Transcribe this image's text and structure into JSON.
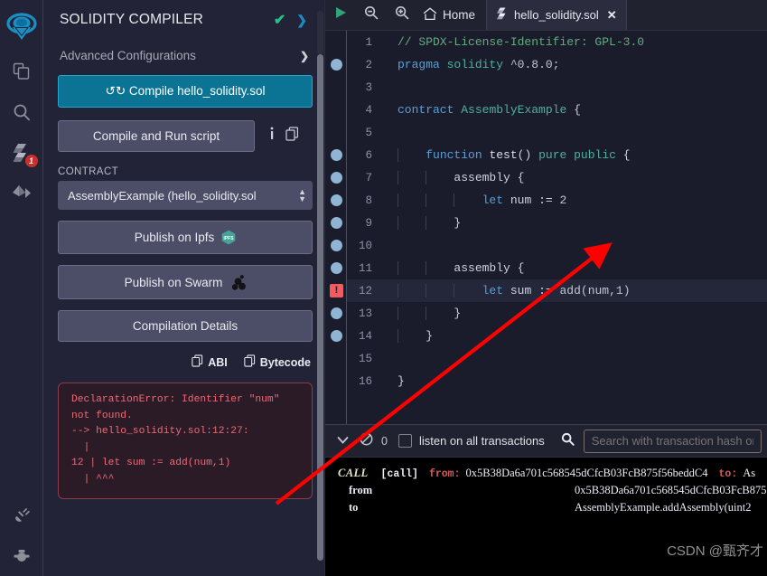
{
  "colors": {
    "accent_blue": "#0b7495",
    "panel_bg": "#222336",
    "editor_bg": "#1b1c2b",
    "error_red": "#ef6a78",
    "success_green": "#28c08a",
    "badge_red": "#c9302c",
    "arrow_red": "#ff0000"
  },
  "icon_rail": {
    "items": [
      {
        "name": "remix-logo",
        "label": "Remix"
      },
      {
        "name": "file-explorer-icon",
        "label": "File explorers"
      },
      {
        "name": "search-icon",
        "label": "Search in files"
      },
      {
        "name": "solidity-compiler-icon",
        "label": "Solidity compiler",
        "badge": "1"
      },
      {
        "name": "deploy-run-icon",
        "label": "Deploy & run transactions"
      }
    ],
    "bottom_items": [
      {
        "name": "plugin-manager-icon",
        "label": "Plugin manager"
      },
      {
        "name": "settings-gear-icon",
        "label": "Settings"
      }
    ]
  },
  "sidebar": {
    "title": "SOLIDITY COMPILER",
    "status_check": "✔",
    "expand_chevron": "❯",
    "advanced_configurations": "Advanced Configurations",
    "advanced_chevron": "❯",
    "compile_button": "Compile hello_solidity.sol",
    "compile_refresh_icon": "refresh-icon",
    "run_script_button": "Compile and Run script",
    "info_icon": "info-icon",
    "copy_icon": "copy-icon",
    "contract_label": "CONTRACT",
    "contract_selected": "AssemblyExample (hello_solidity.sol",
    "publish_ipfs": "Publish on Ipfs",
    "ipfs_badge_text": "IPFS",
    "publish_swarm": "Publish on Swarm",
    "compilation_details": "Compilation Details",
    "abi_label": "ABI",
    "bytecode_label": "Bytecode",
    "error_message": "DeclarationError: Identifier \"num\" not found.\n--> hello_solidity.sol:12:27:\n  |\n12 | let sum := add(num,1)\n  | ^^^"
  },
  "tabbar": {
    "run_icon": "play-icon",
    "zoom_out_icon": "zoom-out-icon",
    "zoom_in_icon": "zoom-in-icon",
    "home_label": "Home",
    "home_icon": "home-icon",
    "tabs": [
      {
        "name": "tab-hello-solidity",
        "label": "hello_solidity.sol",
        "icon": "solidity-file-icon",
        "active": true,
        "close": "✕"
      }
    ]
  },
  "editor": {
    "lines": [
      {
        "n": "1",
        "text": "// SPDX-License-Identifier: GPL-3.0",
        "type": "comment",
        "indent": 0,
        "breakpoint": false
      },
      {
        "n": "2",
        "text": "pragma solidity ^0.8.0;",
        "type": "pragma",
        "indent": 0,
        "breakpoint": true
      },
      {
        "n": "3",
        "text": "",
        "type": "plain",
        "indent": 0,
        "breakpoint": false
      },
      {
        "n": "4",
        "text": "contract AssemblyExample {",
        "type": "contract",
        "indent": 0,
        "breakpoint": false
      },
      {
        "n": "5",
        "text": "",
        "type": "plain",
        "indent": 0,
        "breakpoint": false
      },
      {
        "n": "6",
        "text": "function test() pure public {",
        "type": "function",
        "indent": 1,
        "breakpoint": true
      },
      {
        "n": "7",
        "text": "assembly {",
        "type": "plain",
        "indent": 2,
        "breakpoint": true
      },
      {
        "n": "8",
        "text": "let num := 2",
        "type": "let",
        "indent": 3,
        "breakpoint": true
      },
      {
        "n": "9",
        "text": "}",
        "type": "plain",
        "indent": 2,
        "breakpoint": true
      },
      {
        "n": "10",
        "text": "",
        "type": "plain",
        "indent": 0,
        "breakpoint": true
      },
      {
        "n": "11",
        "text": "assembly {",
        "type": "plain",
        "indent": 2,
        "breakpoint": true
      },
      {
        "n": "12",
        "text": "let sum := add(num,1)",
        "type": "let",
        "indent": 3,
        "breakpoint": false,
        "error": true,
        "highlight": true
      },
      {
        "n": "13",
        "text": "}",
        "type": "plain",
        "indent": 2,
        "breakpoint": true
      },
      {
        "n": "14",
        "text": "}",
        "type": "plain",
        "indent": 1,
        "breakpoint": true
      },
      {
        "n": "15",
        "text": "",
        "type": "plain",
        "indent": 0,
        "breakpoint": false
      },
      {
        "n": "16",
        "text": "}",
        "type": "plain",
        "indent": 0,
        "breakpoint": false
      }
    ]
  },
  "terminal": {
    "collapse_icon": "chevron-down-icon",
    "clear_icon": "ban-icon",
    "pending_count": "0",
    "listen_label": "listen on all transactions",
    "listen_checked": false,
    "search_icon": "search-icon",
    "search_placeholder": "Search with transaction hash or address",
    "log": {
      "badge": "CALL",
      "tag": "[call]",
      "from_key": "from:",
      "from_value": "0x5B38Da6a701c568545dCfcB03FcB875f56beddC4",
      "to_key": "to:",
      "to_value_short": "As",
      "rows": [
        {
          "key": "from",
          "value": "0x5B38Da6a701c568545dCfcB03FcB875"
        },
        {
          "key": "to",
          "value": "AssemblyExample.addAssembly(uint2"
        }
      ]
    },
    "watermark": "CSDN @甄齐才"
  }
}
